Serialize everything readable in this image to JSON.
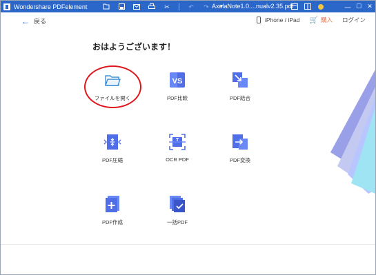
{
  "window": {
    "app_title": "Wondershare PDFelement",
    "document_name": "AxelaNote1.0....nualv2.35.pdf"
  },
  "topbar": {
    "back_label": "戻る",
    "device_label": "iPhone / iPad",
    "buy_label": "購入",
    "login_label": "ログイン"
  },
  "greeting": "おはようございます！",
  "tools": [
    {
      "label": "ファイルを開く",
      "icon": "folder-open-icon"
    },
    {
      "label": "PDF比較",
      "icon": "pdf-compare-icon"
    },
    {
      "label": "PDF結合",
      "icon": "pdf-merge-icon"
    },
    {
      "label": "PDF圧縮",
      "icon": "pdf-compress-icon"
    },
    {
      "label": "OCR PDF",
      "icon": "ocr-icon"
    },
    {
      "label": "PDF変換",
      "icon": "pdf-convert-icon"
    },
    {
      "label": "PDF作成",
      "icon": "pdf-create-icon"
    },
    {
      "label": "一括PDF",
      "icon": "batch-pdf-icon"
    }
  ],
  "colors": {
    "titlebar": "#2b66c9",
    "accent": "#3b5bdb",
    "highlight": "#e0141b",
    "buy": "#e8734a"
  }
}
